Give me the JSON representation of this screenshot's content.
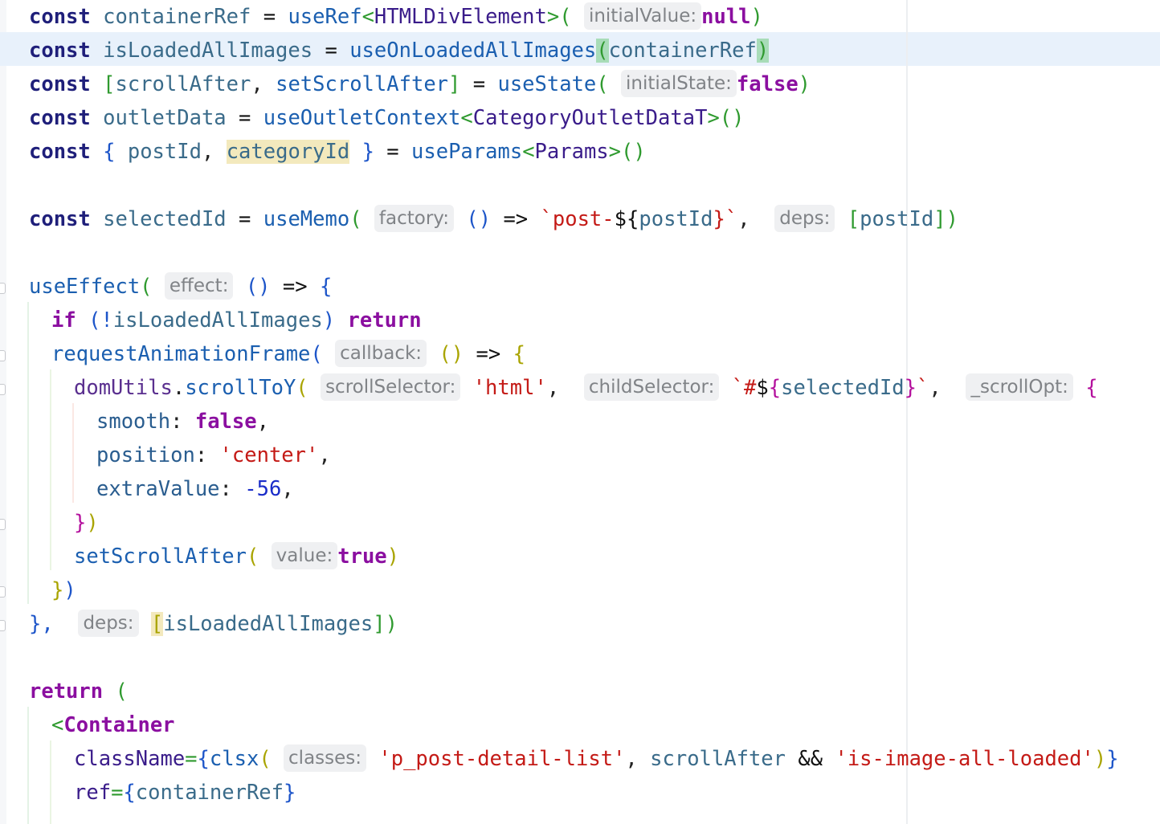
{
  "editor": {
    "lines": [
      {
        "id": "l1",
        "parts": [
          "const",
          "containerRef",
          "=",
          "useRef",
          "<",
          "HTMLDivElement",
          ">(",
          "initialValue:",
          "null",
          ")"
        ]
      },
      {
        "id": "l2",
        "parts": [
          "const",
          "isLoadedAllImages",
          "=",
          "useOnLoadedAllImages",
          "(",
          "containerRef",
          ")"
        ]
      },
      {
        "id": "l3",
        "parts": [
          "const",
          "[",
          "scrollAfter",
          ",",
          "setScrollAfter",
          "]",
          "=",
          "useState",
          "(",
          "initialState:",
          "false",
          ")"
        ]
      },
      {
        "id": "l4",
        "parts": [
          "const",
          "outletData",
          "=",
          "useOutletContext",
          "<",
          "CategoryOutletDataT",
          ">()"
        ]
      },
      {
        "id": "l5",
        "parts": [
          "const",
          "{",
          "postId",
          ",",
          "categoryId",
          "}",
          "=",
          "useParams",
          "<",
          "Params",
          ">()"
        ]
      },
      {
        "id": "l7",
        "parts": [
          "const",
          "selectedId",
          "=",
          "useMemo",
          "(",
          "factory:",
          "()",
          "=>",
          "`post-",
          "${",
          "postId",
          "}`",
          ",",
          "deps:",
          "[",
          "postId",
          "])"
        ]
      },
      {
        "id": "l9",
        "parts": [
          "useEffect",
          "(",
          "effect:",
          "()",
          "=>",
          "{"
        ]
      },
      {
        "id": "l10",
        "parts": [
          "if",
          "(!",
          "isLoadedAllImages",
          ")",
          "return"
        ]
      },
      {
        "id": "l11",
        "parts": [
          "requestAnimationFrame",
          "(",
          "callback:",
          "()",
          "=>",
          "{"
        ]
      },
      {
        "id": "l12",
        "parts": [
          "domUtils",
          ".",
          "scrollToY",
          "(",
          "scrollSelector:",
          "'html'",
          ",",
          "childSelector:",
          "`#",
          "$",
          "{",
          "selectedId",
          "}",
          "`",
          ",",
          "_scrollOpt:",
          "{"
        ]
      },
      {
        "id": "l13",
        "parts": [
          "smooth",
          ":",
          "false",
          ","
        ]
      },
      {
        "id": "l14",
        "parts": [
          "position",
          ":",
          "'center'",
          ","
        ]
      },
      {
        "id": "l15",
        "parts": [
          "extraValue",
          ":",
          "-56",
          ","
        ]
      },
      {
        "id": "l16",
        "parts": [
          "}",
          ")"
        ]
      },
      {
        "id": "l17",
        "parts": [
          "setScrollAfter",
          "(",
          "value:",
          "true",
          ")"
        ]
      },
      {
        "id": "l18",
        "parts": [
          "}",
          ")"
        ]
      },
      {
        "id": "l19",
        "parts": [
          "},",
          "deps:",
          "[",
          "isLoadedAllImages",
          "])"
        ]
      },
      {
        "id": "l21",
        "parts": [
          "return",
          "("
        ]
      },
      {
        "id": "l22",
        "parts": [
          "<",
          "Container"
        ]
      },
      {
        "id": "l23",
        "parts": [
          "className",
          "=",
          "{",
          "clsx",
          "(",
          "classes:",
          "'p_post-detail-list'",
          ",",
          "scrollAfter",
          "&&",
          "'is-image-all-loaded'",
          ")",
          "}"
        ]
      },
      {
        "id": "l24",
        "parts": [
          "ref",
          "=",
          "{",
          "containerRef",
          "}"
        ]
      }
    ]
  }
}
